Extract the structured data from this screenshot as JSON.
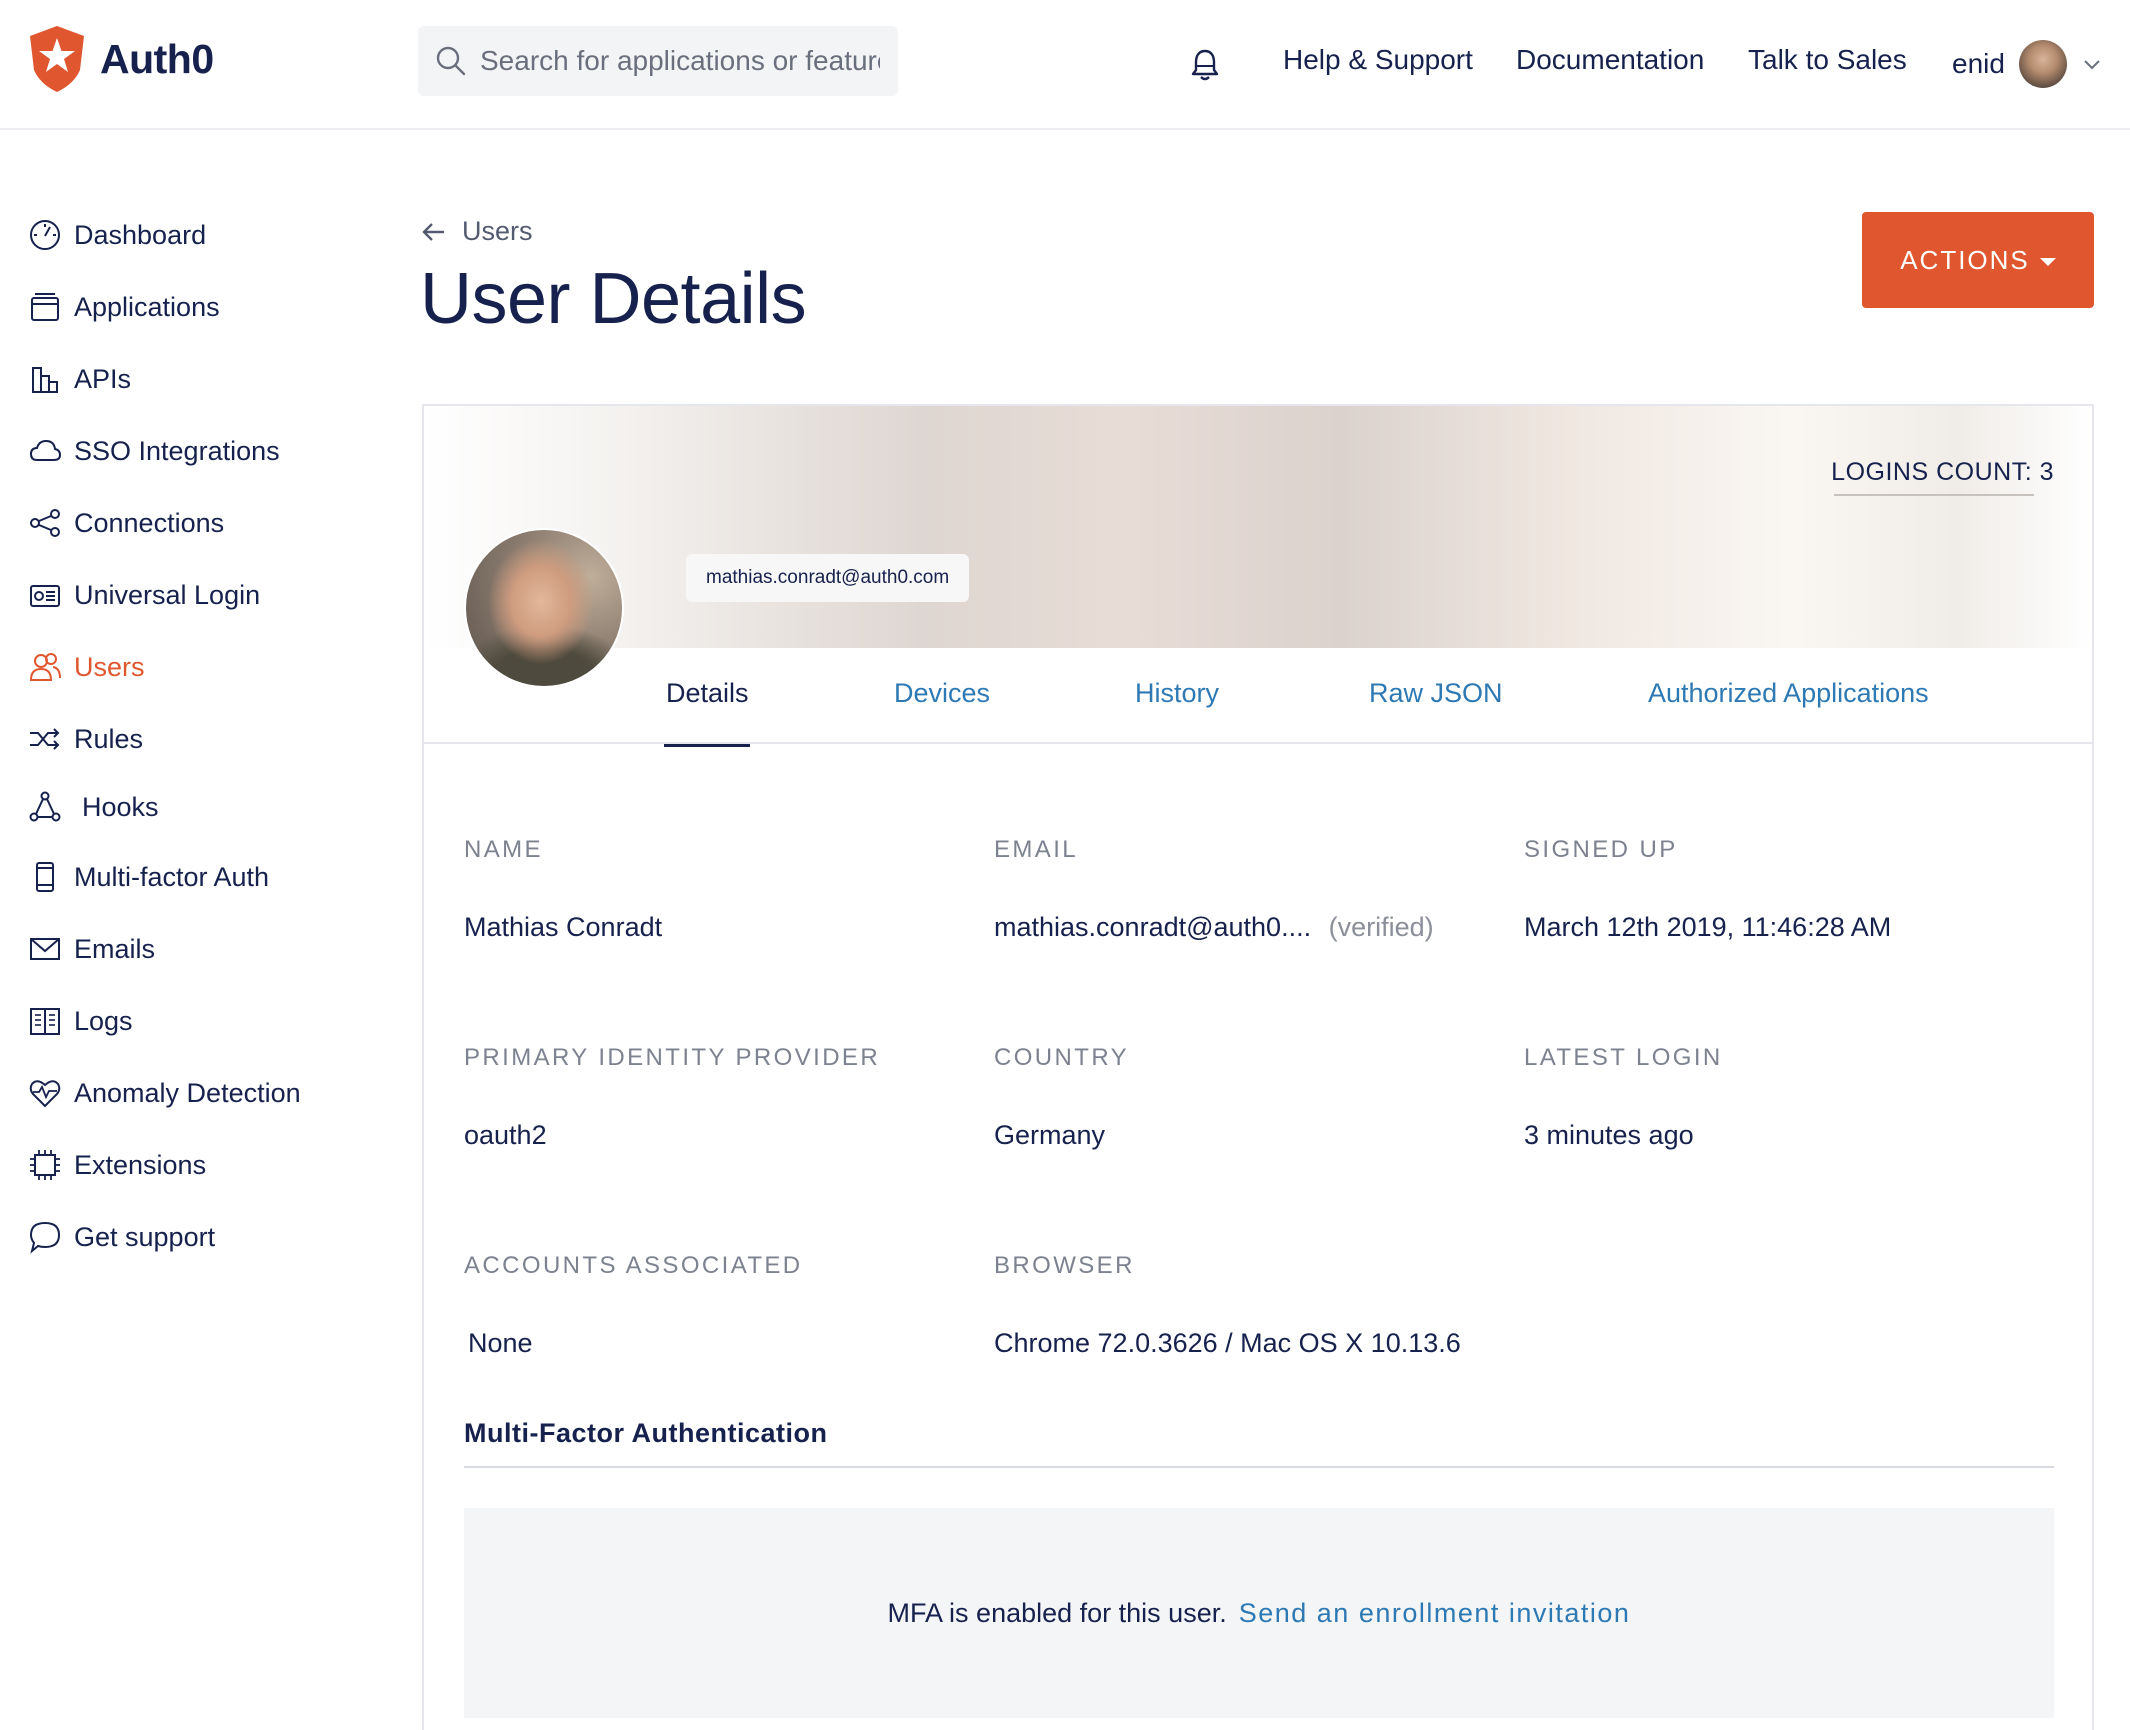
{
  "brand": {
    "name": "Auth0",
    "accent": "#e0572f",
    "navy": "#16214d",
    "link": "#2d79b4"
  },
  "search": {
    "placeholder": "Search for applications or features"
  },
  "topnav": {
    "help": "Help & Support",
    "docs": "Documentation",
    "sales": "Talk to Sales",
    "username": "enid"
  },
  "sidebar": {
    "items": [
      {
        "label": "Dashboard",
        "icon": "dashboard-icon"
      },
      {
        "label": "Applications",
        "icon": "applications-icon"
      },
      {
        "label": "APIs",
        "icon": "apis-icon"
      },
      {
        "label": "SSO Integrations",
        "icon": "cloud-icon"
      },
      {
        "label": "Connections",
        "icon": "connections-icon"
      },
      {
        "label": "Universal Login",
        "icon": "universal-login-icon"
      },
      {
        "label": "Users",
        "icon": "users-icon",
        "active": true
      },
      {
        "label": "Rules",
        "icon": "rules-icon"
      },
      {
        "label": "Hooks",
        "icon": "hooks-icon"
      },
      {
        "label": "Multi-factor Auth",
        "icon": "phone-icon"
      },
      {
        "label": "Emails",
        "icon": "mail-icon"
      },
      {
        "label": "Logs",
        "icon": "book-icon"
      },
      {
        "label": "Anomaly Detection",
        "icon": "heart-icon"
      },
      {
        "label": "Extensions",
        "icon": "chip-icon"
      },
      {
        "label": "Get support",
        "icon": "chat-bubble-icon"
      }
    ]
  },
  "page": {
    "back_label": "Users",
    "title": "User Details",
    "actions_label": "ACTIONS"
  },
  "profile": {
    "logins_count": "LOGINS COUNT: 3",
    "email_pill": "mathias.conradt@auth0.com"
  },
  "tabs": [
    "Details",
    "Devices",
    "History",
    "Raw JSON",
    "Authorized Applications"
  ],
  "details": {
    "name_label": "NAME",
    "name": "Mathias Conradt",
    "email_label": "EMAIL",
    "email": "mathias.conradt@auth0....",
    "email_status": "(verified)",
    "signed_up_label": "SIGNED UP",
    "signed_up": "March 12th 2019, 11:46:28 AM",
    "provider_label": "PRIMARY IDENTITY PROVIDER",
    "provider": "oauth2",
    "country_label": "COUNTRY",
    "country": "Germany",
    "latest_login_label": "LATEST LOGIN",
    "latest_login": "3 minutes ago",
    "accounts_label": "ACCOUNTS ASSOCIATED",
    "accounts": "None",
    "browser_label": "BROWSER",
    "browser": "Chrome 72.0.3626 / Mac OS X 10.13.6"
  },
  "mfa": {
    "heading": "Multi-Factor Authentication",
    "text": "MFA is enabled for this user.",
    "link": "Send an enrollment invitation"
  }
}
